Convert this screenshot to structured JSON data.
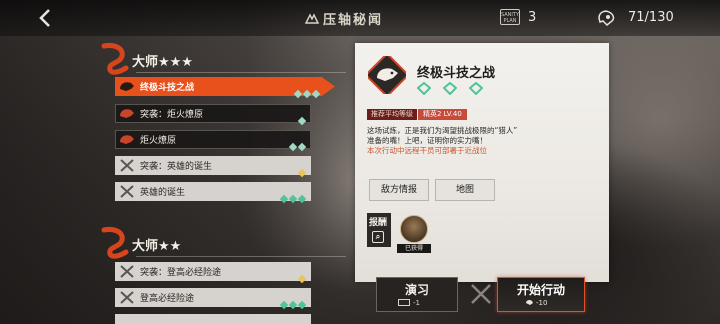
{
  "topbar": {
    "stage_title": "压轴秘闻",
    "plan_label": "SANITY PLAN",
    "plan_count": "3",
    "sanity_value": "71/130"
  },
  "tiers": [
    {
      "label": "大师★★★"
    },
    {
      "label": "大师★★"
    }
  ],
  "stages": [
    {
      "name": "终极斗技之战",
      "style": "selected",
      "rank": 3,
      "rank_color": "#9fd8c4"
    },
    {
      "name": "突袭：炬火燎原",
      "style": "dark",
      "rank": 1,
      "rank_color": "#9fd8c4"
    },
    {
      "name": "炬火燎原",
      "style": "dark",
      "rank": 2,
      "rank_color": "#9fd8c4"
    },
    {
      "name": "突袭：英雄的诞生",
      "style": "light",
      "rank": 1,
      "rank_color": "#e8c45a"
    },
    {
      "name": "英雄的诞生",
      "style": "light",
      "rank": 3,
      "rank_color": "#4fc39a"
    },
    {
      "name": "突袭：登高必经险途",
      "style": "light",
      "rank": 1,
      "rank_color": "#e8c45a"
    },
    {
      "name": "登高必经险途",
      "style": "light",
      "rank": 3,
      "rank_color": "#4fc39a"
    }
  ],
  "detail": {
    "name": "终极斗技之战",
    "level_key": "推荐平均等级",
    "level_value": "精英2 LV.40",
    "desc_line1": "这场试炼，正是我们为渴望挑战极限的“猎人”",
    "desc_line2": "准备的嘴！上吧，证明你的实力嘴！",
    "desc_warn": "本次行动中远程干员可部署于近战位",
    "intel_label": "敌方情报",
    "map_label": "地图",
    "reward_label": "报酬",
    "reward_status": "已获得"
  },
  "actions": {
    "practice_label": "演习",
    "practice_cost": "-1",
    "start_label": "开始行动",
    "start_cost": "-10"
  },
  "colors": {
    "accent": "#e8501c",
    "badge_green": "#4fc39a"
  }
}
